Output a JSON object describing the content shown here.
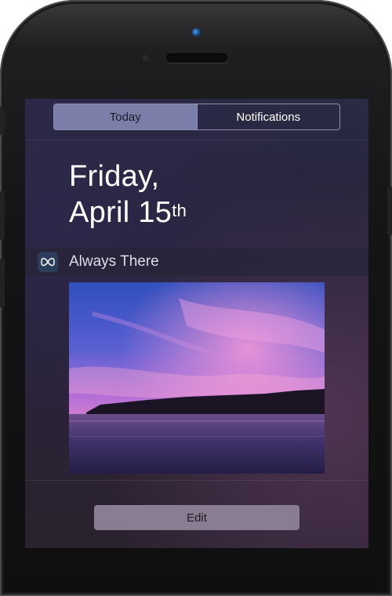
{
  "tabs": [
    {
      "label": "Today",
      "active": true
    },
    {
      "label": "Notifications",
      "active": false
    }
  ],
  "date": {
    "weekday_line": "Friday,",
    "month_day": "April 15",
    "ordinal_suffix": "th"
  },
  "widget": {
    "title": "Always There",
    "icon": "infinity-icon"
  },
  "edit_label": "Edit",
  "colors": {
    "segment_active": "#7a7ea8",
    "edit_button": "#8a7d92",
    "camera_accent": "#4aa3ff"
  }
}
